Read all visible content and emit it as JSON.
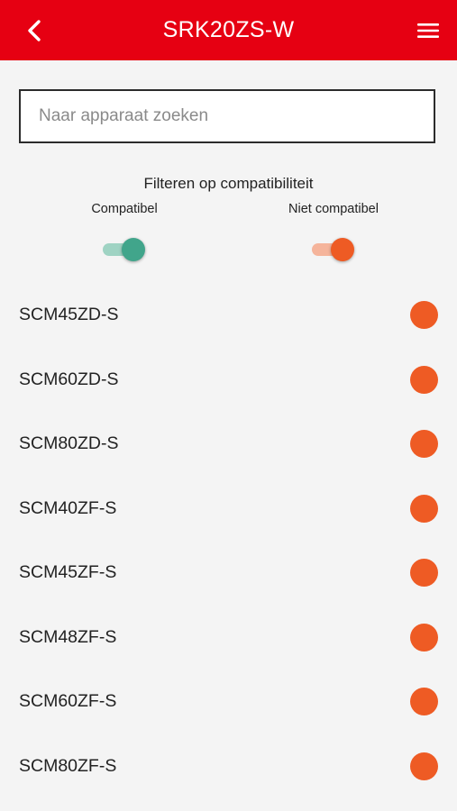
{
  "header": {
    "title": "SRK20ZS-W",
    "back_icon": "chevron-left-icon",
    "menu_icon": "hamburger-menu-icon",
    "bg_color": "#e60012"
  },
  "search": {
    "placeholder": "Naar apparaat zoeken",
    "value": ""
  },
  "filter": {
    "title": "Filteren op compatibiliteit",
    "compatible": {
      "label": "Compatibel",
      "on": true,
      "track_color": "#9fd3c3",
      "knob_color": "#41a58b"
    },
    "incompatible": {
      "label": "Niet compatibel",
      "on": true,
      "track_color": "#f5b49b",
      "knob_color": "#ee5b24"
    }
  },
  "devices": [
    {
      "name": "SCM45ZD-S",
      "status": "incompatible",
      "color": "#ee5b24"
    },
    {
      "name": "SCM60ZD-S",
      "status": "incompatible",
      "color": "#ee5b24"
    },
    {
      "name": "SCM80ZD-S",
      "status": "incompatible",
      "color": "#ee5b24"
    },
    {
      "name": "SCM40ZF-S",
      "status": "incompatible",
      "color": "#ee5b24"
    },
    {
      "name": "SCM45ZF-S",
      "status": "incompatible",
      "color": "#ee5b24"
    },
    {
      "name": "SCM48ZF-S",
      "status": "incompatible",
      "color": "#ee5b24"
    },
    {
      "name": "SCM60ZF-S",
      "status": "incompatible",
      "color": "#ee5b24"
    },
    {
      "name": "SCM80ZF-S",
      "status": "incompatible",
      "color": "#ee5b24"
    }
  ]
}
